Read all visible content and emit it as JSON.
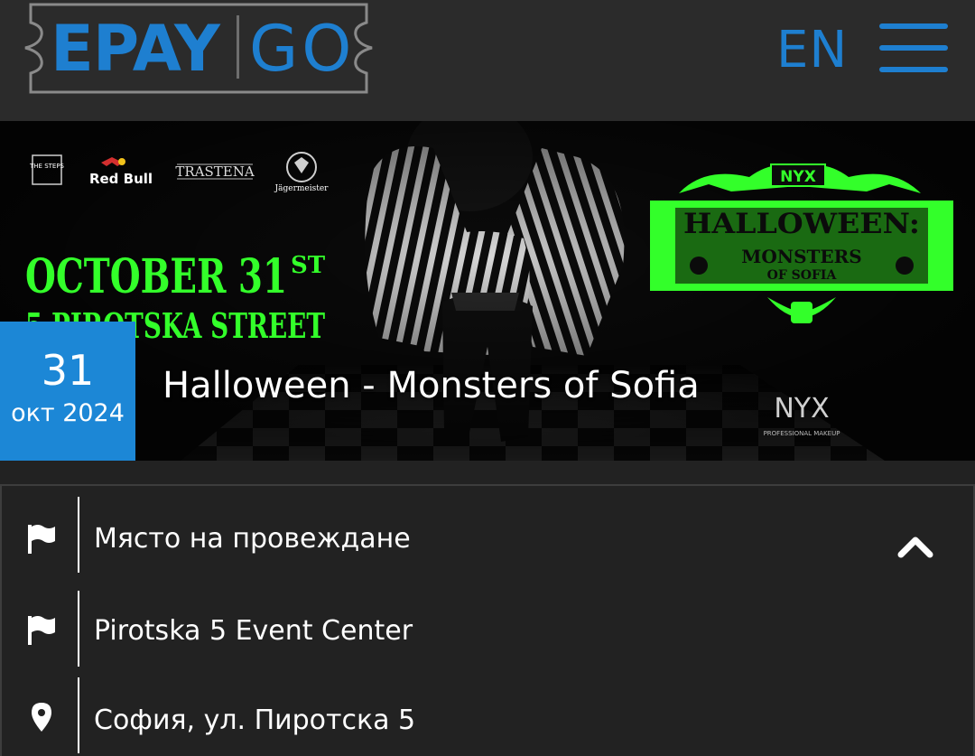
{
  "header": {
    "logo_left": "EPAY",
    "logo_right": "GO",
    "language": "EN",
    "menu_icon": "hamburger-menu-icon"
  },
  "banner": {
    "sponsor_logos": [
      "THE STEPS",
      "Red Bull",
      "TRASTENA",
      "Jägermeister"
    ],
    "poster_date": "OCTOBER 31",
    "poster_date_suffix": "ST",
    "poster_street": "5 PIROTSKA STREET",
    "poster_badge_title": "HALLOWEEN:",
    "poster_badge_sub1": "MONSTERS",
    "poster_badge_sub2": "OF SOFIA",
    "poster_badge_brand": "NYX",
    "poster_corner_brand": "NYX",
    "poster_corner_brand_sub": "PROFESSIONAL MAKEUP",
    "colors": {
      "neon_green": "#33ff2a",
      "date_box": "#1c87d6"
    }
  },
  "event": {
    "day": "31",
    "month_year": "окт 2024",
    "title": "Halloween - Monsters of Sofia"
  },
  "venue": {
    "section_label": "Място на провеждане",
    "name": "Pirotska 5 Event Center",
    "address": "София, ул. Пиротска 5",
    "icons": [
      "flag-icon",
      "flag-icon",
      "map-pin-icon"
    ],
    "toggle_icon": "chevron-up-icon"
  }
}
